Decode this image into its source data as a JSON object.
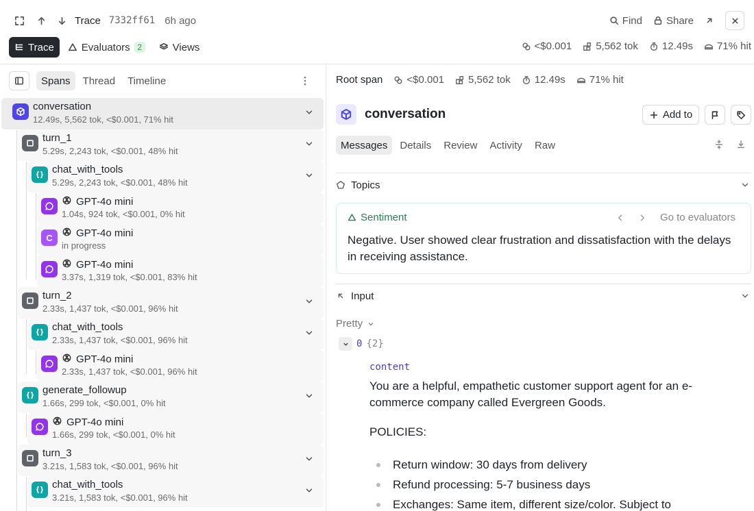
{
  "header": {
    "title": "Trace",
    "hash": "7332ff61",
    "age": "6h ago",
    "find_label": "Find",
    "share_label": "Share"
  },
  "nav": {
    "tabs": [
      {
        "label": "Trace",
        "active": true
      },
      {
        "label": "Evaluators",
        "badge": "2"
      },
      {
        "label": "Views"
      }
    ]
  },
  "stats": {
    "cost": "<$0.001",
    "tokens": "5,562 tok",
    "duration": "12.49s",
    "hit": "71% hit"
  },
  "left_panel": {
    "tabs": [
      {
        "label": "Spans",
        "active": true
      },
      {
        "label": "Thread"
      },
      {
        "label": "Timeline"
      }
    ],
    "spans": [
      {
        "name": "conversation",
        "meta": "12.49s, 5,562 tok, <$0.001, 71% hit",
        "icon": "cube-icon",
        "color": "#4f46e5",
        "depth": 0,
        "selected": true
      },
      {
        "name": "turn_1",
        "meta": "5.29s, 2,243 tok, <$0.001, 48% hit",
        "icon": "square-icon",
        "color": "#5f6368",
        "depth": 1
      },
      {
        "name": "chat_with_tools",
        "meta": "5.29s, 2,243 tok, <$0.001, 48% hit",
        "icon": "braces-icon",
        "color": "#0ea5a4",
        "depth": 2
      },
      {
        "name": "GPT-4o mini",
        "meta": "1.04s, 924 tok, <$0.001, 0% hit",
        "icon": "chat-bubble-icon",
        "color": "#9333ea",
        "depth": 3
      },
      {
        "name": "GPT-4o mini",
        "meta": "in progress",
        "icon": "letter-c-icon",
        "letter": "C",
        "color": "#a855f7",
        "depth": 3
      },
      {
        "name": "GPT-4o mini",
        "meta": "3.37s, 1,319 tok, <$0.001, 83% hit",
        "icon": "chat-bubble-icon",
        "color": "#9333ea",
        "depth": 3
      },
      {
        "name": "turn_2",
        "meta": "2.33s, 1,437 tok, <$0.001, 96% hit",
        "icon": "square-icon",
        "color": "#5f6368",
        "depth": 1
      },
      {
        "name": "chat_with_tools",
        "meta": "2.33s, 1,437 tok, <$0.001, 96% hit",
        "icon": "braces-icon",
        "color": "#0ea5a4",
        "depth": 2
      },
      {
        "name": "GPT-4o mini",
        "meta": "2.33s, 1,437 tok, <$0.001, 96% hit",
        "icon": "chat-bubble-icon",
        "color": "#9333ea",
        "depth": 3
      },
      {
        "name": "generate_followup",
        "meta": "1.66s, 299 tok, <$0.001, 0% hit",
        "icon": "braces-icon",
        "color": "#0ea5a4",
        "depth": 1
      },
      {
        "name": "GPT-4o mini",
        "meta": "1.66s, 299 tok, <$0.001, 0% hit",
        "icon": "chat-bubble-icon",
        "color": "#9333ea",
        "depth": 2
      },
      {
        "name": "turn_3",
        "meta": "3.21s, 1,583 tok, <$0.001, 96% hit",
        "icon": "square-icon",
        "color": "#5f6368",
        "depth": 1
      },
      {
        "name": "chat_with_tools",
        "meta": "3.21s, 1,583 tok, <$0.001, 96% hit",
        "icon": "braces-icon",
        "color": "#0ea5a4",
        "depth": 2
      }
    ]
  },
  "right_panel": {
    "root_label": "Root span",
    "title": "conversation",
    "add_to_label": "Add to",
    "tabs": [
      {
        "label": "Messages",
        "active": true
      },
      {
        "label": "Details"
      },
      {
        "label": "Review"
      },
      {
        "label": "Activity"
      },
      {
        "label": "Raw"
      }
    ],
    "topics_label": "Topics",
    "sentiment": {
      "label": "Sentiment",
      "goto": "Go to evaluators",
      "text": "Negative. User showed clear frustration and dissatisfaction with the delays in receiving assistance."
    },
    "input_label": "Input",
    "pretty_label": "Pretty",
    "json_index": "0",
    "json_count": "{2}",
    "content_key": "content",
    "content_text": "You are a helpful, empathetic customer support agent for an e-commerce company called Evergreen Goods.",
    "policies_label": "POLICIES:",
    "policies": [
      "Return window: 30 days from delivery",
      "Refund processing: 5-7 business days",
      "Exchanges: Same item, different size/color. Subject to"
    ]
  }
}
